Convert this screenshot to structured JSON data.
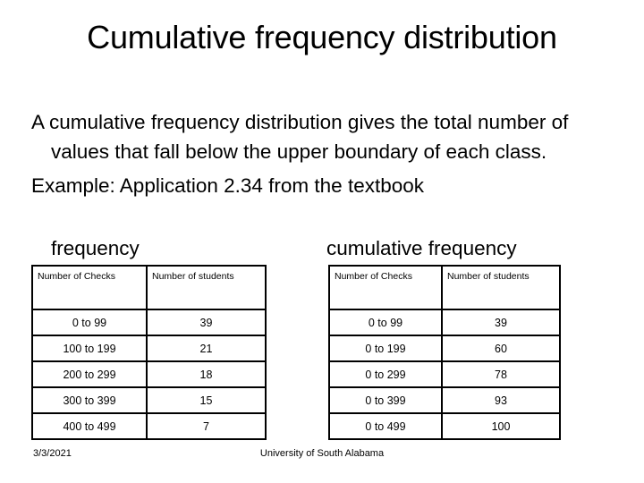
{
  "slide": {
    "title": "Cumulative frequency distribution",
    "body": {
      "paragraph_1_line_1": "A cumulative frequency distribution gives the total",
      "paragraph_1_rest": "number of values that fall below the upper boundary of each class.",
      "paragraph_2_line_1": "Example: Application 2.34 from the textbook"
    },
    "captions": {
      "left": "frequency",
      "right": "cumulative frequency"
    },
    "footer": {
      "date": "3/3/2021",
      "organization": "University of South Alabama"
    }
  },
  "frequency_table": {
    "headers": [
      "Number of Checks",
      "Number of students"
    ],
    "rows": [
      [
        "0 to 99",
        "39"
      ],
      [
        "100 to 199",
        "21"
      ],
      [
        "200 to 299",
        "18"
      ],
      [
        "300 to 399",
        "15"
      ],
      [
        "400 to 499",
        "7"
      ]
    ]
  },
  "cumulative_table": {
    "headers": [
      "Number of Checks",
      "Number of students"
    ],
    "rows": [
      [
        "0 to 99",
        "39"
      ],
      [
        "0 to 199",
        "60"
      ],
      [
        "0 to 299",
        "78"
      ],
      [
        "0 to 399",
        "93"
      ],
      [
        "0 to 499",
        "100"
      ]
    ]
  },
  "chart_data": {
    "type": "table",
    "title": "Cumulative frequency distribution",
    "xlabel": "Number of Checks",
    "ylabel": "Number of students",
    "categories": [
      "0 to 99",
      "100 to 199",
      "200 to 299",
      "300 to 399",
      "400 to 499"
    ],
    "series": [
      {
        "name": "frequency",
        "values": [
          39,
          21,
          18,
          15,
          7
        ]
      },
      {
        "name": "cumulative frequency",
        "values": [
          39,
          60,
          78,
          93,
          100
        ]
      }
    ],
    "cumulative_categories": [
      "0 to 99",
      "0 to 199",
      "0 to 299",
      "0 to 399",
      "0 to 499"
    ],
    "grid": false,
    "legend": "none"
  },
  "colors": {
    "background": "#ffffff",
    "text": "#000000",
    "table_border": "#000000"
  }
}
